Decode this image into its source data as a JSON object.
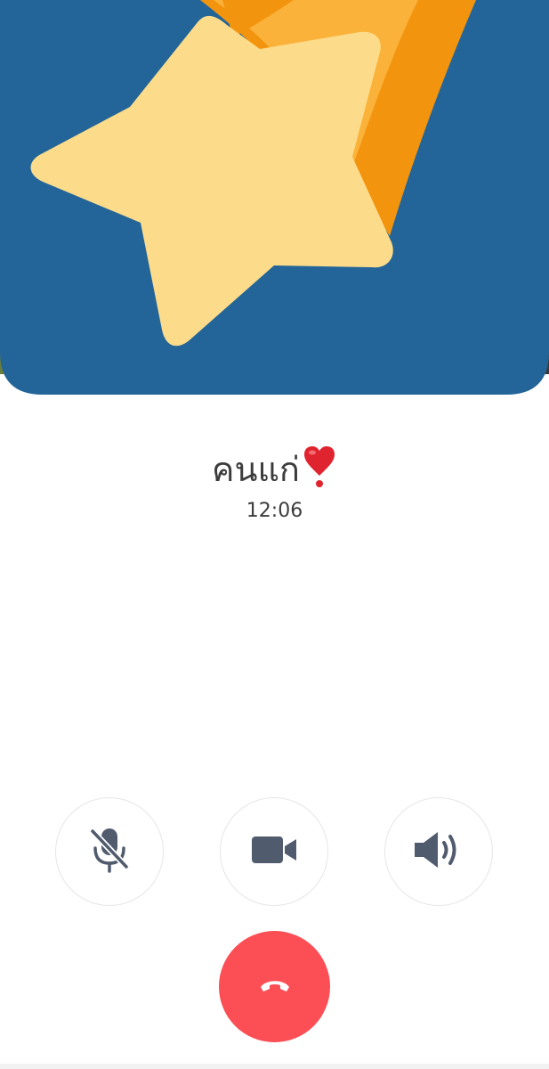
{
  "call": {
    "caller_name": "คนแก่",
    "duration": "12:06"
  },
  "controls": {
    "mute_icon": "microphone-off-icon",
    "video_icon": "video-camera-icon",
    "speaker_icon": "speaker-volume-icon",
    "end_call_icon": "phone-hangup-icon"
  },
  "colors": {
    "profile_background": "#236598",
    "star": "#fcdc8b",
    "streak_orange": "#f3940f",
    "streak_light": "#fbb23a",
    "end_call": "#fb4e55",
    "control_icon": "#515b6e",
    "text": "#3c3c3c"
  }
}
